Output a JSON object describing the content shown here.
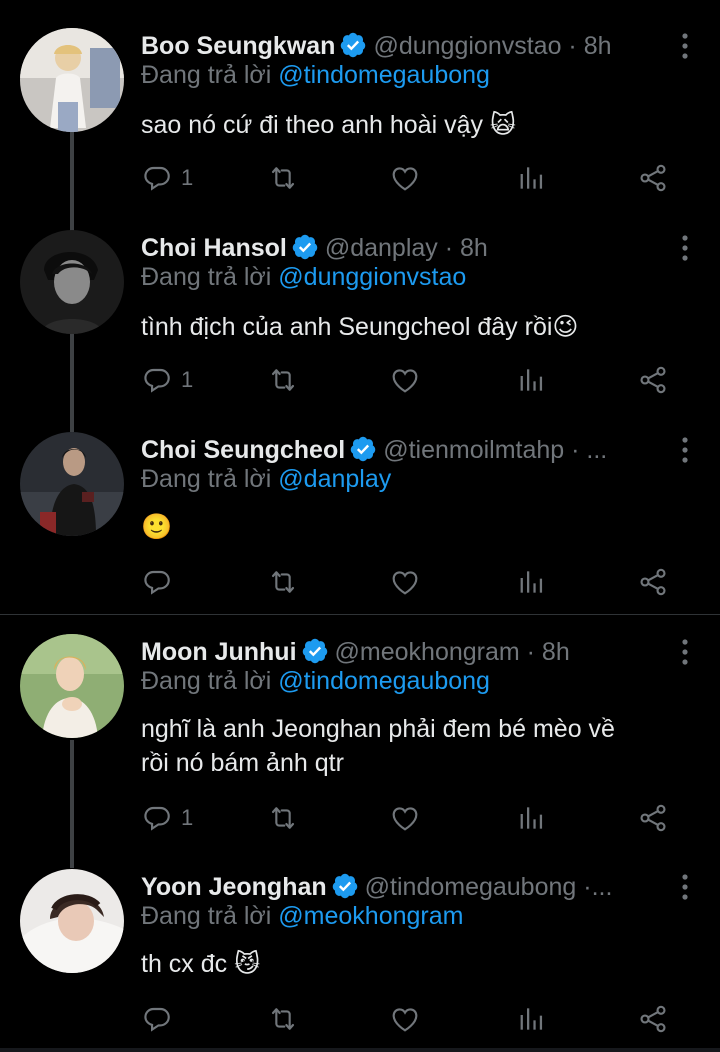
{
  "colors": {
    "background": "#000000",
    "text": "#e7e9ea",
    "muted": "#71767b",
    "link": "#1d9bf0",
    "verified": "#1d9bf0"
  },
  "replying_prefix": "Đang trả lời",
  "tweets": [
    {
      "name": "Boo Seungkwan",
      "meta": "@dunggionvstao · 8h",
      "replying_to": "@tindomegaubong",
      "text": "sao nó cứ đi theo anh hoài vậy 🙀",
      "reply_count": "1",
      "avatar_icon": "avatar-boo-seungkwan"
    },
    {
      "name": "Choi Hansol",
      "meta": "@danplay · 8h",
      "replying_to": "@dunggionvstao",
      "text": "tình địch của anh Seungcheol đây rồi😉",
      "reply_count": "1",
      "avatar_icon": "avatar-choi-hansol"
    },
    {
      "name": "Choi Seungcheol",
      "meta": "@tienmoilmtahp · ...",
      "replying_to": "@danplay",
      "text": "🙂",
      "reply_count": "",
      "avatar_icon": "avatar-choi-seungcheol"
    },
    {
      "name": "Moon Junhui",
      "meta": "@meokhongram · 8h",
      "replying_to": "@tindomegaubong",
      "text_line1": "nghĩ là anh Jeonghan phải đem bé mèo về",
      "text_line2": "rồi nó bám ảnh qtr",
      "reply_count": "1",
      "avatar_icon": "avatar-moon-junhui"
    },
    {
      "name": "Yoon Jeonghan",
      "meta": "@tindomegaubong ·...",
      "replying_to": "@meokhongram",
      "text": "th cx đc 😼",
      "reply_count": "",
      "avatar_icon": "avatar-yoon-jeonghan"
    }
  ]
}
